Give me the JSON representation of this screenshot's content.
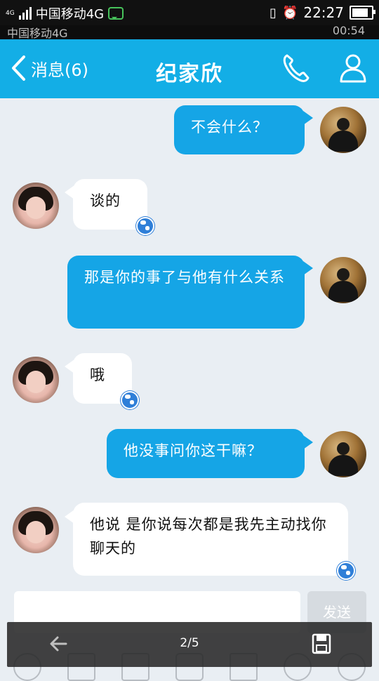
{
  "status_bar": {
    "network_label": "4G",
    "carrier": "中国移动4G",
    "time": "22:27",
    "battery_level": 0.9,
    "icons": [
      "signal-icon",
      "message-notification-icon",
      "vibrate-icon",
      "alarm-icon",
      "battery-icon"
    ]
  },
  "ghost_bar": {
    "carrier": "中国移动4G",
    "time": "00:54"
  },
  "header": {
    "back_label": "消息(6)",
    "title": "纪家欣",
    "icons": [
      "phone-icon",
      "profile-icon"
    ],
    "accent_color": "#13aee6"
  },
  "messages": [
    {
      "direction": "out",
      "text": "不会什么？"
    },
    {
      "direction": "in",
      "text": "谈的"
    },
    {
      "direction": "out",
      "text": "那是你的事了与他有什么关系"
    },
    {
      "direction": "in",
      "text": "哦"
    },
    {
      "direction": "out",
      "text": "他没事问你这干嘛？"
    },
    {
      "direction": "in",
      "text": "他说 是你说每次都是我先主动找你聊天的"
    }
  ],
  "composer": {
    "send_label": "发送",
    "tool_icons": [
      "mic-icon",
      "video-icon",
      "image-icon",
      "camera-icon",
      "red-packet-icon",
      "emoji-icon",
      "plus-icon"
    ]
  },
  "viewer": {
    "page_indicator": "2/5"
  }
}
